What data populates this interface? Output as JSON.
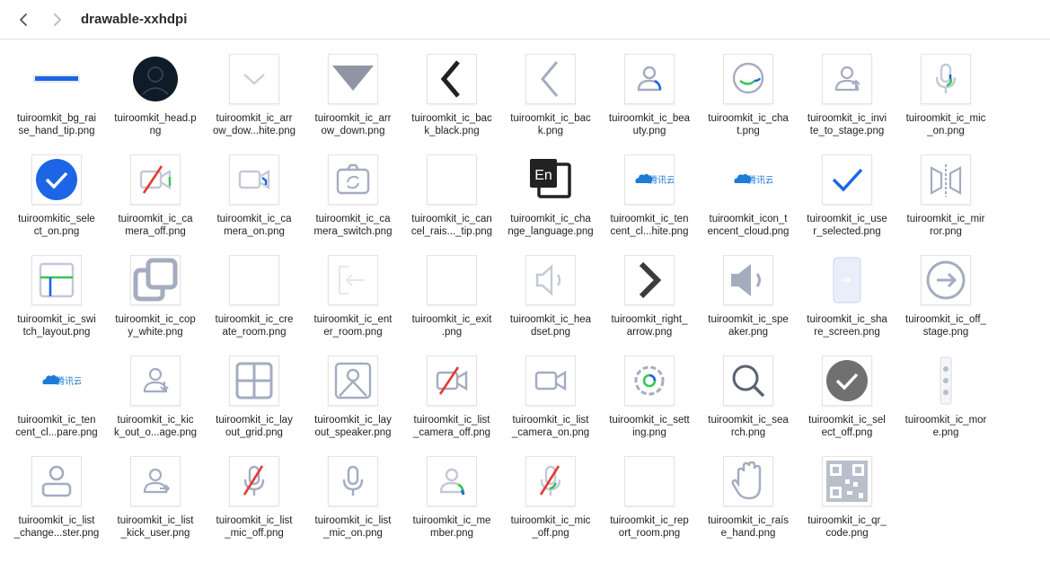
{
  "window": {
    "title": "drawable-xxhdpi",
    "back_icon": "chevron-left-icon",
    "forward_icon": "chevron-right-icon"
  },
  "files": [
    {
      "name": "tuiroomkit_bg_rai\nse_hand_tip.png",
      "icon": "raise-hand-tip-bar"
    },
    {
      "name": "tuiroomkit_head.p\nng",
      "icon": "avatar-head"
    },
    {
      "name": "tuiroomkit_ic_arr\now_dow...hite.png",
      "icon": "chevron-down"
    },
    {
      "name": "tuiroomkit_ic_arr\now_down.png",
      "icon": "triangle-down"
    },
    {
      "name": "tuiroomkit_ic_bac\nk_black.png",
      "icon": "chevron-left-black"
    },
    {
      "name": "tuiroomkit_ic_bac\nk.png",
      "icon": "chevron-left-gray"
    },
    {
      "name": "tuiroomkit_ic_bea\nuty.png",
      "icon": "beauty"
    },
    {
      "name": "tuiroomkit_ic_cha\nt.png",
      "icon": "chat"
    },
    {
      "name": "tuiroomkit_ic_invi\nte_to_stage.png",
      "icon": "invite-to-stage"
    },
    {
      "name": "tuiroomkit_ic_mic\n_on.png",
      "icon": "mic-on-green"
    },
    {
      "name": "tuiroomkitic_sele\nct_on.png",
      "icon": "select-on"
    },
    {
      "name": "tuiroomkit_ic_ca\nmera_off.png",
      "icon": "camera-off"
    },
    {
      "name": "tuiroomkit_ic_ca\nmera_on.png",
      "icon": "camera-on"
    },
    {
      "name": "tuiroomkit_ic_ca\nmera_switch.png",
      "icon": "camera-switch"
    },
    {
      "name": "tuiroomkit_ic_can\ncel_rais..._tip.png",
      "icon": "blank"
    },
    {
      "name": "tuiroomkit_ic_cha\nnge_language.png",
      "icon": "change-language"
    },
    {
      "name": "tuiroomkit_ic_ten\ncent_cl...hite.png",
      "icon": "tencent-cloud-white"
    },
    {
      "name": "tuiroomkit_icon_t\nencent_cloud.png",
      "icon": "tencent-cloud"
    },
    {
      "name": "tuiroomkit_ic_use\nr_selected.png",
      "icon": "check-blue"
    },
    {
      "name": "tuiroomkit_ic_mir\nror.png",
      "icon": "mirror"
    },
    {
      "name": "tuiroomkit_ic_swi\ntch_layout.png",
      "icon": "switch-layout"
    },
    {
      "name": "tuiroomkit_ic_cop\ny_white.png",
      "icon": "copy"
    },
    {
      "name": "tuiroomkit_ic_cre\nate_room.png",
      "icon": "blank"
    },
    {
      "name": "tuiroomkit_ic_ent\ner_room.png",
      "icon": "enter-room"
    },
    {
      "name": "tuiroomkit_ic_exit\n.png",
      "icon": "blank"
    },
    {
      "name": "tuiroomkit_ic_hea\ndset.png",
      "icon": "headset"
    },
    {
      "name": "tuiroomkit_right_\narrow.png",
      "icon": "right-arrow"
    },
    {
      "name": "tuiroomkit_ic_spe\naker.png",
      "icon": "speaker"
    },
    {
      "name": "tuiroomkit_ic_sha\nre_screen.png",
      "icon": "share-screen"
    },
    {
      "name": "tuiroomkit_ic_off_\nstage.png",
      "icon": "off-stage"
    },
    {
      "name": "tuiroomkit_ic_ten\ncent_cl...pare.png",
      "icon": "tencent-cloud-transparent"
    },
    {
      "name": "tuiroomkit_ic_kic\nk_out_o...age.png",
      "icon": "kick-out-stage"
    },
    {
      "name": "tuiroomkit_ic_lay\nout_grid.png",
      "icon": "layout-grid"
    },
    {
      "name": "tuiroomkit_ic_lay\nout_speaker.png",
      "icon": "layout-speaker"
    },
    {
      "name": "tuiroomkit_ic_list\n_camera_off.png",
      "icon": "list-camera-off"
    },
    {
      "name": "tuiroomkit_ic_list\n_camera_on.png",
      "icon": "list-camera-on"
    },
    {
      "name": "tuiroomkit_ic_sett\ning.png",
      "icon": "setting"
    },
    {
      "name": "tuiroomkit_ic_sea\nrch.png",
      "icon": "search"
    },
    {
      "name": "tuiroomkit_ic_sel\nect_off.png",
      "icon": "select-off"
    },
    {
      "name": "tuiroomkit_ic_mor\ne.png",
      "icon": "more"
    },
    {
      "name": "tuiroomkit_ic_list\n_change...ster.png",
      "icon": "list-change-master"
    },
    {
      "name": "tuiroomkit_ic_list\n_kick_user.png",
      "icon": "list-kick-user"
    },
    {
      "name": "tuiroomkit_ic_list\n_mic_off.png",
      "icon": "list-mic-off"
    },
    {
      "name": "tuiroomkit_ic_list\n_mic_on.png",
      "icon": "list-mic-on"
    },
    {
      "name": "tuiroomkit_ic_me\nmber.png",
      "icon": "member"
    },
    {
      "name": "tuiroomkit_ic_mic\n_off.png",
      "icon": "mic-off"
    },
    {
      "name": "tuiroomkit_ic_rep\nort_room.png",
      "icon": "blank"
    },
    {
      "name": "tuiroomkit_ic_raís\ne_hand.png",
      "icon": "raise-hand"
    },
    {
      "name": "tuiroomkit_ic_qr_\ncode.png",
      "icon": "qr-code"
    }
  ],
  "icon_text": {
    "language": "En",
    "tencent_cloud": "腾讯云"
  },
  "colors": {
    "accent_blue": "#1c66e5",
    "icon_gray": "#a4acc0",
    "dark": "#222222",
    "green": "#34c759"
  }
}
